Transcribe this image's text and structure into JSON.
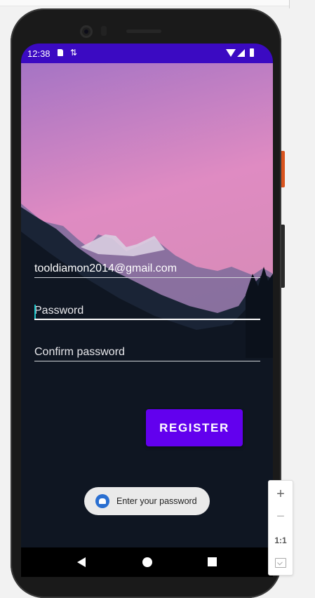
{
  "status_bar": {
    "time": "12:38",
    "sync_glyph": "⇅",
    "background": "#3b0ac2",
    "icons": [
      "sd-card-icon",
      "sync-icon",
      "wifi-icon",
      "signal-icon",
      "battery-icon"
    ]
  },
  "form": {
    "email_value": "tooldiamon2014@gmail.com",
    "password_placeholder": "Password",
    "confirm_password_placeholder": "Confirm password"
  },
  "register_button": {
    "label": "REGISTER",
    "color": "#6200ee"
  },
  "toast": {
    "text": "Enter your password",
    "icon": "android-icon"
  },
  "nav_bar": {
    "icons": [
      "back-icon",
      "home-icon",
      "recents-icon"
    ]
  },
  "zoom_controls": {
    "zoom_in_label": "+",
    "zoom_out_label": "−",
    "actual_size_label": "1:1",
    "fit_icon": "fit-screen-icon"
  }
}
